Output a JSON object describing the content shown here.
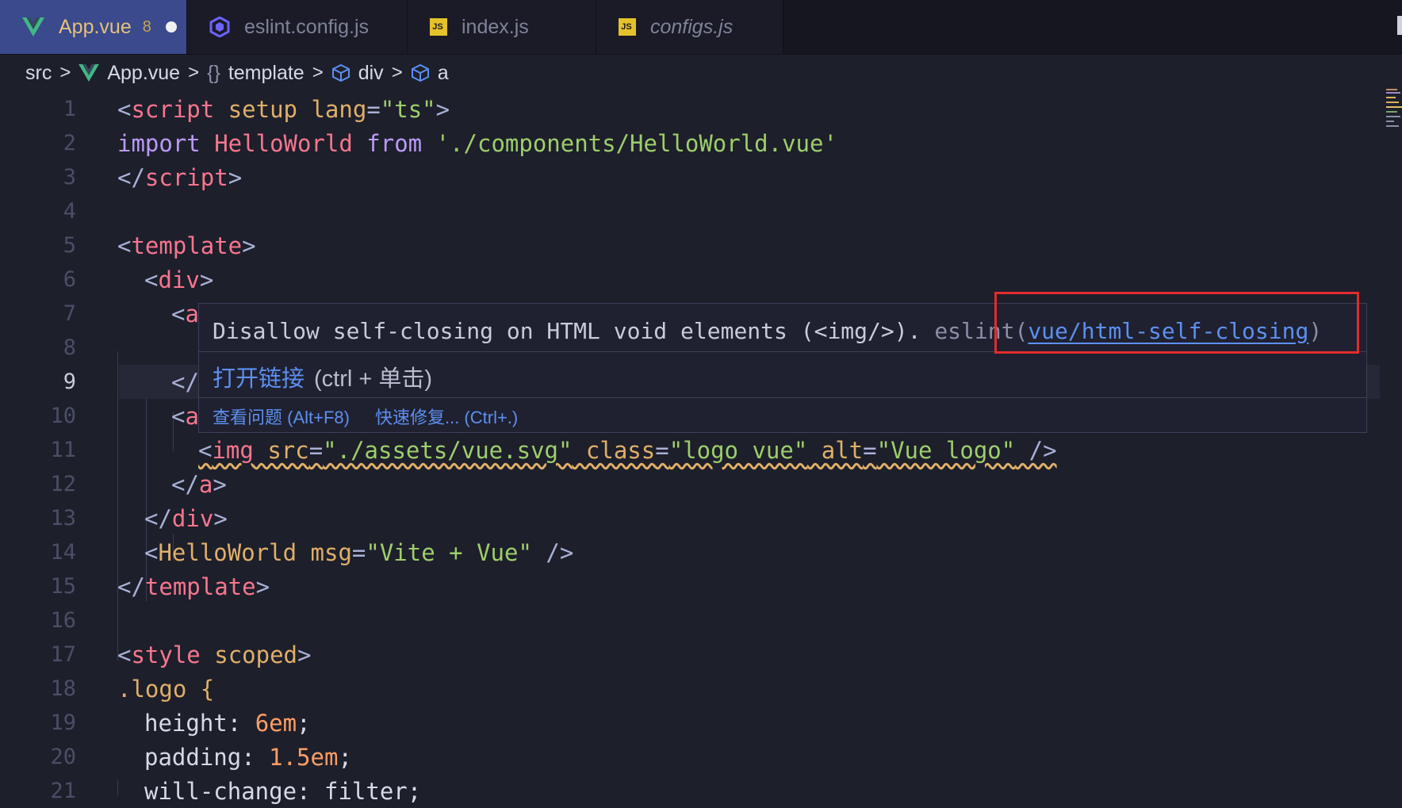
{
  "tabs": [
    {
      "label": "App.vue",
      "icon": "vue-icon",
      "dirty_count": "8",
      "active": true
    },
    {
      "label": "eslint.config.js",
      "icon": "eslint-icon"
    },
    {
      "label": "index.js",
      "icon": "js-icon",
      "icon_text": "JS"
    },
    {
      "label": "configs.js",
      "icon": "js-icon",
      "icon_text": "JS"
    }
  ],
  "breadcrumb": {
    "items": [
      "src",
      "App.vue",
      "template",
      "div",
      "a"
    ],
    "braces": "{}"
  },
  "line_numbers": [
    "1",
    "2",
    "3",
    "4",
    "5",
    "6",
    "7",
    "8",
    "9",
    "10",
    "11",
    "12",
    "13",
    "14",
    "15",
    "16",
    "17",
    "18",
    "19",
    "20",
    "21"
  ],
  "current_line": "9",
  "code": {
    "l1": [
      "<",
      "script",
      " setup",
      " lang",
      "=",
      "\"ts\"",
      ">"
    ],
    "l2": [
      "import",
      " HelloWorld",
      " from",
      " './components/HelloWorld.vue'"
    ],
    "l3": [
      "</",
      "script",
      ">"
    ],
    "l5": [
      "<",
      "template",
      ">"
    ],
    "l6": [
      "<",
      "div",
      ">"
    ],
    "l7": [
      "<",
      "a"
    ],
    "l9": [
      "</"
    ],
    "l10": [
      "<",
      "a"
    ],
    "l11": [
      "<",
      "img",
      " src",
      "=",
      "\"./assets/vue.svg\"",
      " class",
      "=",
      "\"logo vue\"",
      " alt",
      "=",
      "\"Vue logo\"",
      " />"
    ],
    "l12": [
      "</",
      "a",
      ">"
    ],
    "l13": [
      "</",
      "div",
      ">"
    ],
    "l14": [
      "<",
      "HelloWorld",
      " msg",
      "=",
      "\"Vite + Vue\"",
      " />"
    ],
    "l15": [
      "</",
      "template",
      ">"
    ],
    "l17": [
      "<",
      "style",
      " scoped",
      ">"
    ],
    "l18": [
      ".logo",
      " {"
    ],
    "l19": [
      "height",
      ": ",
      "6em",
      ";"
    ],
    "l20": [
      "padding",
      ": ",
      "1.5em",
      ";"
    ],
    "l21": [
      "will-change",
      ": ",
      "filter",
      ";"
    ]
  },
  "hover": {
    "message": "Disallow self-closing on HTML void elements (<img/>). ",
    "source": "eslint(",
    "rule": "vue/html-self-closing",
    "source_close": ")",
    "open_link": "打开链接",
    "open_hint": "(ctrl + 单击)",
    "view_problem": "查看问题 (Alt+F8)",
    "quick_fix": "快速修复... (Ctrl+.)"
  },
  "colors": {
    "accent": "#5d8ff0",
    "highlight_box": "#e22c2c",
    "tag": "#f7768e",
    "attr": "#e0af68",
    "string": "#9ece6a",
    "keyword": "#bb9af7"
  }
}
